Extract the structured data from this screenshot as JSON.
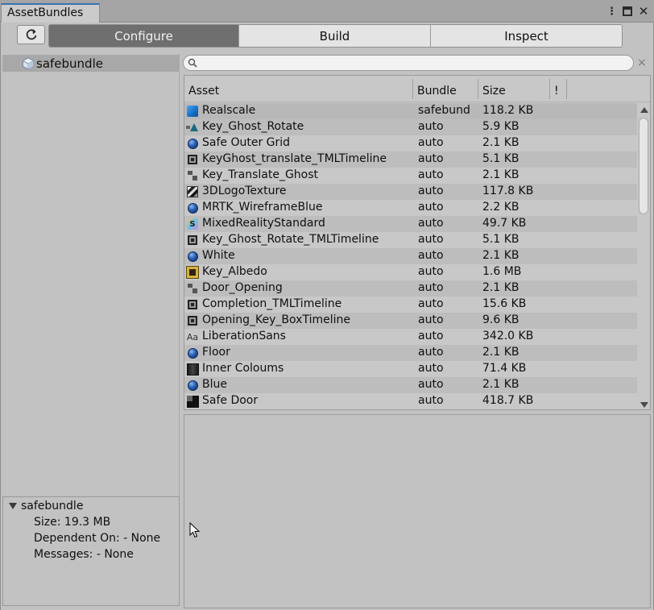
{
  "window": {
    "tab_title": "AssetBundles"
  },
  "toolbar": {
    "refresh_icon": "refresh-icon",
    "tabs": [
      {
        "label": "Configure",
        "active": true
      },
      {
        "label": "Build",
        "active": false
      },
      {
        "label": "Inspect",
        "active": false
      }
    ]
  },
  "bundles": [
    {
      "name": "safebundle",
      "selected": true
    }
  ],
  "details": {
    "title": "safebundle",
    "size": "Size: 19.3 MB",
    "dependent_on": "Dependent On: - None",
    "messages": "Messages: - None"
  },
  "search": {
    "value": "",
    "clear_label": "×"
  },
  "table": {
    "columns": [
      "Asset",
      "Bundle",
      "Size",
      "!"
    ],
    "rows": [
      {
        "icon": "cube",
        "asset": "Realscale",
        "bundle": "safebund",
        "size": "118.2 KB"
      },
      {
        "icon": "ghost",
        "asset": "Key_Ghost_Rotate",
        "bundle": "auto",
        "size": "5.9 KB"
      },
      {
        "icon": "sphere",
        "asset": "Safe Outer Grid",
        "bundle": "auto",
        "size": "2.1 KB"
      },
      {
        "icon": "timeline",
        "asset": "KeyGhost_translate_TMLTimeline",
        "bundle": "auto",
        "size": "5.1 KB"
      },
      {
        "icon": "anim",
        "asset": "Key_Translate_Ghost",
        "bundle": "auto",
        "size": "2.1 KB"
      },
      {
        "icon": "tex3d",
        "asset": "3DLogoTexture",
        "bundle": "auto",
        "size": "117.8 KB"
      },
      {
        "icon": "sphere",
        "asset": "MRTK_WireframeBlue",
        "bundle": "auto",
        "size": "2.2 KB"
      },
      {
        "icon": "shader",
        "asset": "MixedRealityStandard",
        "bundle": "auto",
        "size": "49.7 KB"
      },
      {
        "icon": "timeline",
        "asset": "Key_Ghost_Rotate_TMLTimeline",
        "bundle": "auto",
        "size": "5.1 KB"
      },
      {
        "icon": "sphere",
        "asset": "White",
        "bundle": "auto",
        "size": "2.1 KB"
      },
      {
        "icon": "albedo",
        "asset": "Key_Albedo",
        "bundle": "auto",
        "size": "1.6 MB"
      },
      {
        "icon": "anim",
        "asset": "Door_Opening",
        "bundle": "auto",
        "size": "2.1 KB"
      },
      {
        "icon": "timeline",
        "asset": "Completion_TMLTimeline",
        "bundle": "auto",
        "size": "15.6 KB"
      },
      {
        "icon": "timeline",
        "asset": "Opening_Key_BoxTimeline",
        "bundle": "auto",
        "size": "9.6 KB"
      },
      {
        "icon": "font",
        "asset": "LiberationSans",
        "bundle": "auto",
        "size": "342.0 KB"
      },
      {
        "icon": "sphere",
        "asset": "Floor",
        "bundle": "auto",
        "size": "2.1 KB"
      },
      {
        "icon": "darktex",
        "asset": "Inner Coloums",
        "bundle": "auto",
        "size": "71.4 KB"
      },
      {
        "icon": "sphere",
        "asset": "Blue",
        "bundle": "auto",
        "size": "2.1 KB"
      },
      {
        "icon": "darktex2",
        "asset": "Safe Door",
        "bundle": "auto",
        "size": "418.7 KB"
      }
    ]
  }
}
